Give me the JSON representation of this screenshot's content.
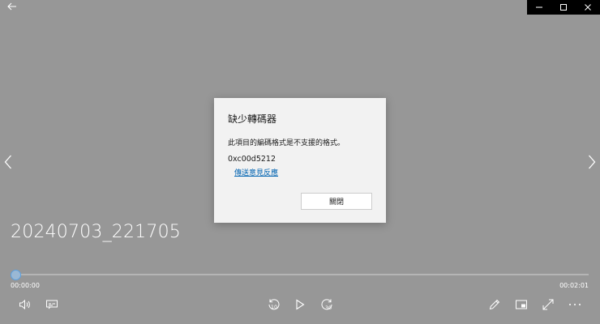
{
  "video": {
    "title": "20240703_221705",
    "time_current": "00:00:00",
    "time_total": "00:02:01",
    "progress": 0.0
  },
  "controls": {
    "skip_back_label": "10",
    "skip_forward_label": "30"
  },
  "dialog": {
    "title": "缺少轉碼器",
    "message": "此項目的編碼格式是不支援的格式。",
    "error_code": "0xc00d5212",
    "feedback_link": "傳送意見反應",
    "close_button": "關閉"
  },
  "colors": {
    "background": "#979797",
    "accent": "#0063b1",
    "dialog_bg": "#f2f2f2"
  }
}
